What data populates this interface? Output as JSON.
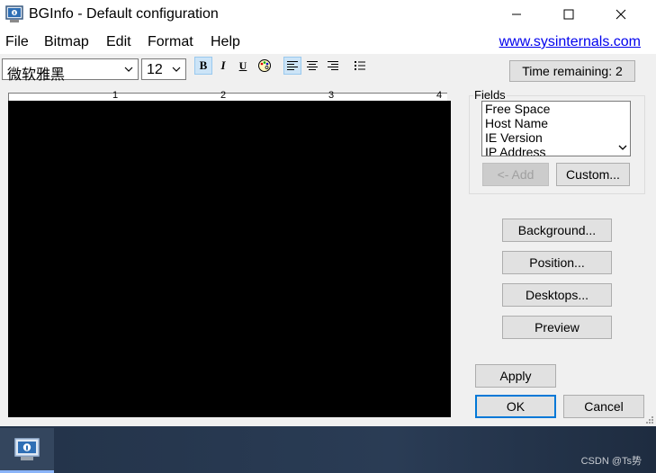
{
  "window": {
    "title": "BGInfo - Default configuration"
  },
  "menu": {
    "items": [
      "File",
      "Bitmap",
      "Edit",
      "Format",
      "Help"
    ],
    "link": "www.sysinternals.com"
  },
  "toolbar": {
    "font_name": "微软雅黑",
    "font_size": "12",
    "bold": "B",
    "italic": "I",
    "underline": "U",
    "time_remaining": "Time remaining: 2"
  },
  "ruler": {
    "marks": [
      "1",
      "2",
      "3",
      "4"
    ]
  },
  "fields": {
    "label": "Fields",
    "items": [
      "Free Space",
      "Host Name",
      "IE Version",
      "IP Address"
    ],
    "add_label": "<- Add",
    "custom_label": "Custom..."
  },
  "buttons": {
    "background": "Background...",
    "position": "Position...",
    "desktops": "Desktops...",
    "preview": "Preview",
    "apply": "Apply",
    "ok": "OK",
    "cancel": "Cancel"
  },
  "taskbar": {
    "watermark": "CSDN @Ts势"
  },
  "colors": {
    "link": "#0000ee",
    "accent": "#0078d7",
    "editor_bg": "#000000"
  }
}
